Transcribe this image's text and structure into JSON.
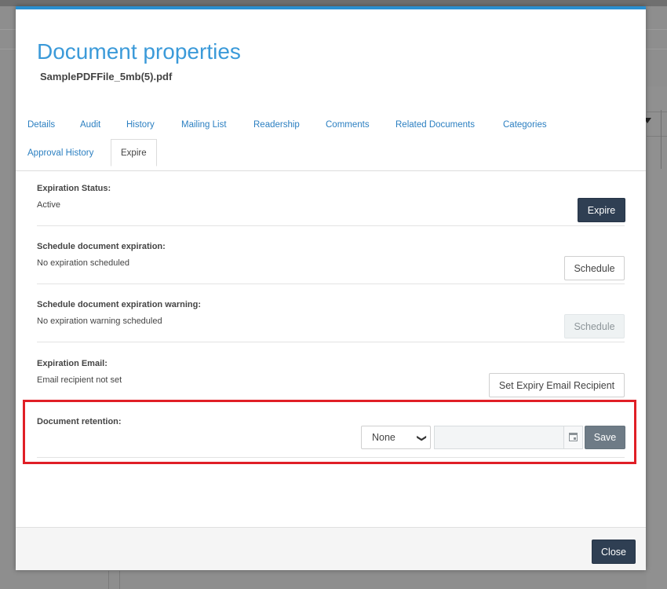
{
  "dialog": {
    "title": "Document properties",
    "filename": "SamplePDFFile_5mb(5).pdf"
  },
  "tabs": {
    "row1": [
      "Details",
      "Audit",
      "History",
      "Mailing List",
      "Readership",
      "Comments",
      "Related Documents",
      "Categories"
    ],
    "row2": [
      "Approval History",
      "Expire"
    ],
    "active": "Expire"
  },
  "expiration_status": {
    "label": "Expiration Status:",
    "value": "Active",
    "button": "Expire"
  },
  "schedule_expiration": {
    "label": "Schedule document expiration:",
    "value": "No expiration scheduled",
    "button": "Schedule"
  },
  "schedule_warning": {
    "label": "Schedule document expiration warning:",
    "value": "No expiration warning scheduled",
    "button": "Schedule",
    "button_disabled": true
  },
  "expiration_email": {
    "label": "Expiration Email:",
    "value": "Email recipient not set",
    "button": "Set Expiry Email Recipient"
  },
  "retention": {
    "label": "Document retention:",
    "select_value": "None",
    "date_value": "",
    "save_button": "Save"
  },
  "footer": {
    "close_button": "Close"
  },
  "colors": {
    "accent": "#2a8fd1",
    "title": "#3b9ad9",
    "dark_button": "#2f3f53",
    "highlight": "#e01f26"
  }
}
